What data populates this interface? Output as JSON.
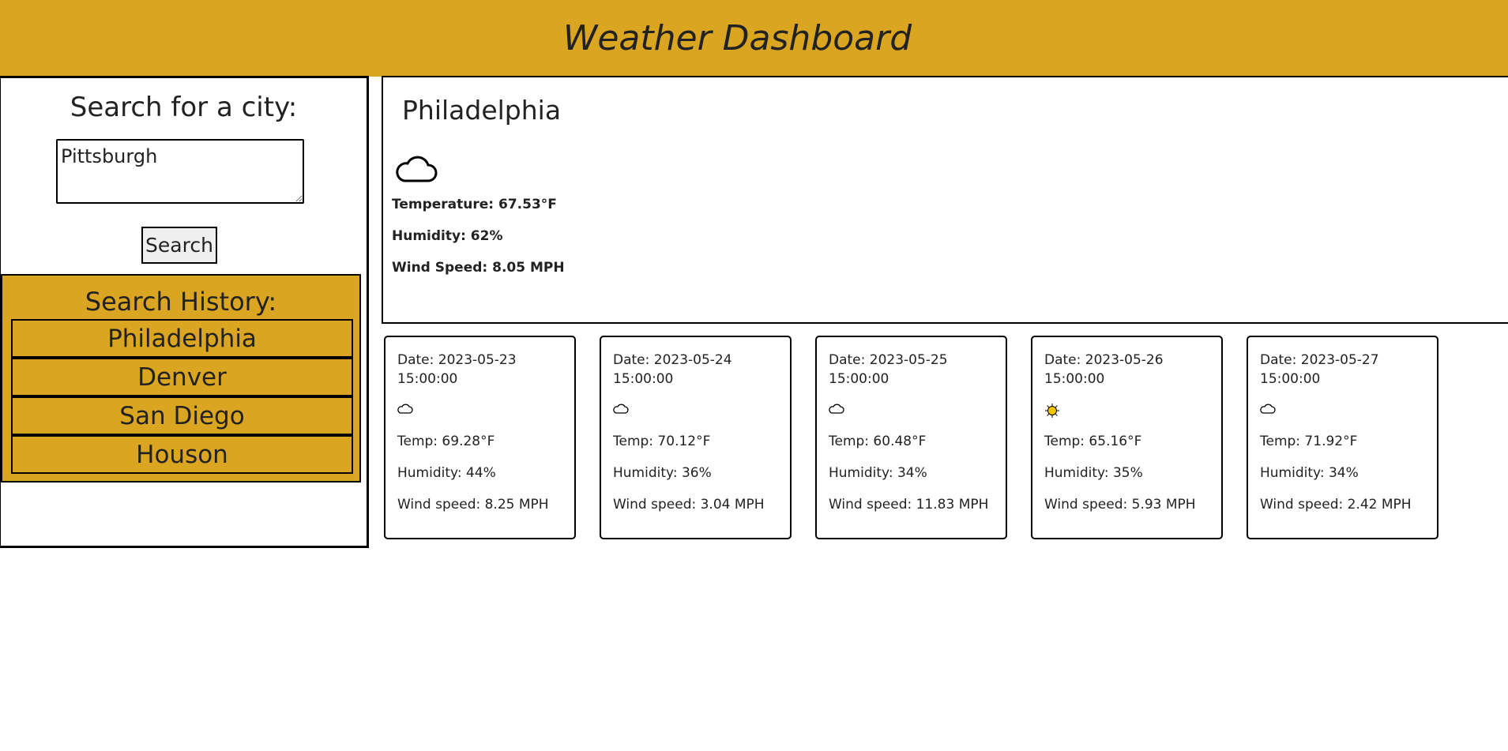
{
  "header": {
    "title": "Weather Dashboard"
  },
  "search": {
    "title": "Search for a city:",
    "input_value": "Pittsburgh",
    "button_label": "Search"
  },
  "history": {
    "title": "Search History:",
    "items": [
      "Philadelphia",
      "Denver",
      "San Diego",
      "Houson"
    ]
  },
  "current": {
    "city": "Philadelphia",
    "icon": "cloud-icon",
    "temperature": "Temperature: 67.53°F",
    "humidity": "Humidity: 62%",
    "wind": "Wind Speed: 8.05 MPH"
  },
  "forecast": [
    {
      "date": "Date: 2023-05-23 15:00:00",
      "icon": "cloud-icon",
      "temp": "Temp: 69.28°F",
      "humidity": "Humidity: 44%",
      "wind": "Wind speed: 8.25 MPH"
    },
    {
      "date": "Date: 2023-05-24 15:00:00",
      "icon": "cloud-icon",
      "temp": "Temp: 70.12°F",
      "humidity": "Humidity: 36%",
      "wind": "Wind speed: 3.04 MPH"
    },
    {
      "date": "Date: 2023-05-25 15:00:00",
      "icon": "cloud-icon",
      "temp": "Temp: 60.48°F",
      "humidity": "Humidity: 34%",
      "wind": "Wind speed: 11.83 MPH"
    },
    {
      "date": "Date: 2023-05-26 15:00:00",
      "icon": "sun-icon",
      "temp": "Temp: 65.16°F",
      "humidity": "Humidity: 35%",
      "wind": "Wind speed: 5.93 MPH"
    },
    {
      "date": "Date: 2023-05-27 15:00:00",
      "icon": "cloud-icon",
      "temp": "Temp: 71.92°F",
      "humidity": "Humidity: 34%",
      "wind": "Wind speed: 2.42 MPH"
    }
  ],
  "colors": {
    "accent": "#DAA520",
    "sun": "#F2C500"
  }
}
